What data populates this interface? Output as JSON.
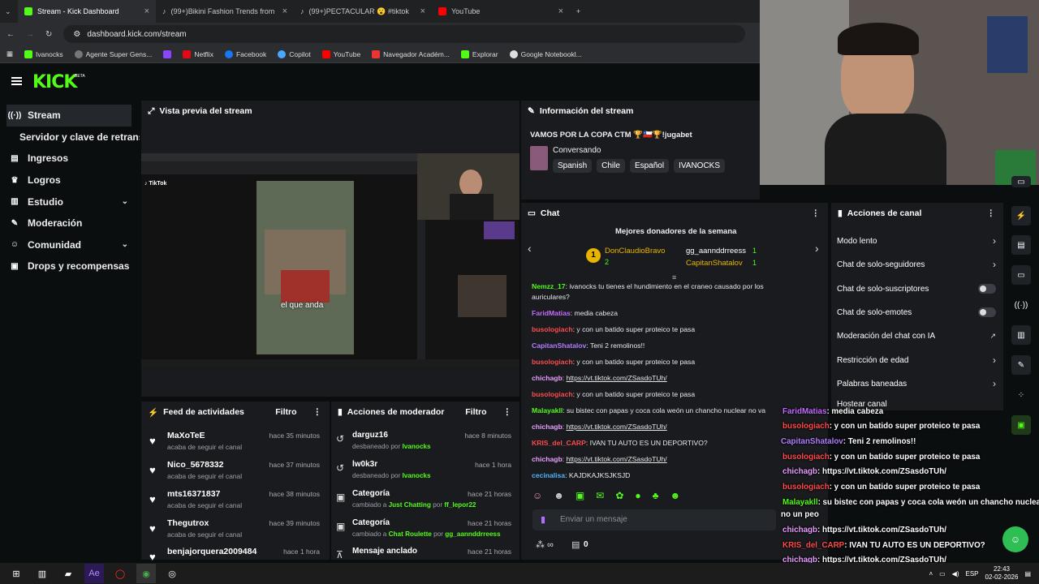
{
  "browser": {
    "tabs": [
      {
        "label": "Stream - Kick Dashboard"
      },
      {
        "label": "(99+)Bikini Fashion Trends from"
      },
      {
        "label": "(99+)PECTACULAR 😮 #tiktok"
      },
      {
        "label": "YouTube"
      }
    ],
    "url": "dashboard.kick.com/stream",
    "bookmarks": [
      "Ivanocks",
      "Agente Super Gens...",
      "Netflix",
      "Facebook",
      "Copilot",
      "YouTube",
      "Navegador Académ...",
      "Explorar",
      "Google Notebookl..."
    ]
  },
  "app": {
    "logo": "KICK",
    "beta": "BETA"
  },
  "sidebar": {
    "items": [
      {
        "label": "Stream"
      },
      {
        "label": "Servidor y clave de retransmisión"
      },
      {
        "label": "Ingresos"
      },
      {
        "label": "Logros"
      },
      {
        "label": "Estudio"
      },
      {
        "label": "Moderación"
      },
      {
        "label": "Comunidad"
      },
      {
        "label": "Drops y recompensas"
      }
    ]
  },
  "preview": {
    "title": "Vista previa del stream",
    "caption": "el que anda"
  },
  "info": {
    "title": "Información del stream",
    "stream_title": "VAMOS POR LA COPA CTM 🏆🇨🇱🏆!jugabet",
    "category": "Conversando",
    "tags": [
      "Spanish",
      "Chile",
      "Español",
      "IVANOCKS"
    ]
  },
  "chat": {
    "title": "Chat",
    "donors_title": "Mejores donadores de la semana",
    "donors": [
      {
        "rank": "1",
        "name": "DonClaudioBravo",
        "amount": "2"
      },
      {
        "rank": "",
        "name": "gg_aannddrreess",
        "amount": "1"
      },
      {
        "rank": "",
        "name": "CapitanShatalov",
        "amount": "1"
      }
    ],
    "messages": [
      {
        "user": "Nemzz_17",
        "color": "#53fc18",
        "text": "ivanocks tu tienes el hundimiento en el craneo causado por los auriculares?"
      },
      {
        "user": "FaridMatias",
        "color": "#c46bff",
        "text": "media cabeza"
      },
      {
        "user": "busologiach",
        "color": "#ff4a4a",
        "text": "y con un batido super proteico te pasa"
      },
      {
        "user": "CapitanShatalov",
        "color": "#b27cff",
        "text": "Teni 2 remolinos!!"
      },
      {
        "user": "busologiach",
        "color": "#ff4a4a",
        "text": "y con un batido super proteico te pasa"
      },
      {
        "user": "chichagb",
        "color": "#e89cff",
        "text": "https://vt.tiktok.com/ZSasdoTUh/"
      },
      {
        "user": "busologiach",
        "color": "#ff4a4a",
        "text": "y con un batido super proteico te pasa"
      },
      {
        "user": "Malayakll",
        "color": "#53fc18",
        "text": "su bistec con papas y coca cola weón un chancho nuclear no va"
      },
      {
        "user": "chichagb",
        "color": "#e89cff",
        "text": "https://vt.tiktok.com/ZSasdoTUh/"
      },
      {
        "user": "KRIS_del_CARP",
        "color": "#ff4a4a",
        "text": "IVAN TU AUTO ES UN DEPORTIVO?"
      },
      {
        "user": "chichagb",
        "color": "#e89cff",
        "text": "https://vt.tiktok.com/ZSasdoTUh/"
      },
      {
        "user": "cecinalisa",
        "color": "#4fb3ff",
        "text": "KAJDKAJKSJKSJD"
      }
    ],
    "placeholder": "Enviar un mensaje",
    "points": "0"
  },
  "actions": {
    "title": "Acciones de canal",
    "items": [
      {
        "label": "Modo lento"
      },
      {
        "label": "Chat de solo-seguidores"
      },
      {
        "label": "Chat de solo-suscriptores"
      },
      {
        "label": "Chat de solo-emotes"
      },
      {
        "label": "Moderación del chat con IA"
      },
      {
        "label": "Restricción de edad"
      },
      {
        "label": "Palabras baneadas"
      },
      {
        "label": "Hostear canal"
      }
    ]
  },
  "feed": {
    "title": "Feed de actividades",
    "filter": "Filtro",
    "rows": [
      {
        "name": "MaXoTeE",
        "sub": "acaba de seguir el canal",
        "time": "hace 35 minutos"
      },
      {
        "name": "Nico_5678332",
        "sub": "acaba de seguir el canal",
        "time": "hace 37 minutos"
      },
      {
        "name": "mts16371837",
        "sub": "acaba de seguir el canal",
        "time": "hace 38 minutos"
      },
      {
        "name": "Thegutrox",
        "sub": "acaba de seguir el canal",
        "time": "hace 39 minutos"
      },
      {
        "name": "benjajorquera2009484",
        "sub": "",
        "time": "hace 1 hora"
      }
    ]
  },
  "modactions": {
    "title": "Acciones de moderador",
    "filter": "Filtro",
    "rows": [
      {
        "name": "darguz16",
        "sub": "desbaneado por",
        "who": "Ivanocks",
        "time": "hace 8 minutos"
      },
      {
        "name": "lw0k3r",
        "sub": "desbaneado por",
        "who": "Ivanocks",
        "time": "hace 1 hora"
      },
      {
        "name": "Categoría",
        "sub": "cambiado a",
        "what": "Just Chatting",
        "by": "por",
        "who": "ff_lepor22",
        "time": "hace 21 horas"
      },
      {
        "name": "Categoría",
        "sub": "cambiado a",
        "what": "Chat Roulette",
        "by": "por",
        "who": "gg_aannddrreess",
        "time": "hace 21 horas"
      },
      {
        "name": "Mensaje anclado",
        "sub": "",
        "who": "",
        "time": "hace 21 horas"
      }
    ]
  },
  "overlay": {
    "lines": [
      {
        "user": "FaridMatias",
        "color": "#c46bff",
        "text": ": media cabeza"
      },
      {
        "user": "busologiach",
        "color": "#ff4a4a",
        "text": ": y con un batido super proteico te pasa"
      },
      {
        "user": "CapitanShatalov",
        "color": "#b27cff",
        "text": ": Teni 2 remolinos!!"
      },
      {
        "user": "busologiach",
        "color": "#ff4a4a",
        "text": ": y con un batido super proteico te pasa"
      },
      {
        "user": "chichagb",
        "color": "#e89cff",
        "text": ": https://vt.tiktok.com/ZSasdoTUh/"
      },
      {
        "user": "busologiach",
        "color": "#ff4a4a",
        "text": ": y con un batido super proteico te pasa"
      },
      {
        "user": "Malayakll",
        "color": "#53fc18",
        "text": ": su bistec con papas y coca cola weón un chancho nuclear"
      },
      {
        "user": "",
        "color": "#fff",
        "text": "no un peo"
      },
      {
        "user": "chichagb",
        "color": "#e89cff",
        "text": ": https://vt.tiktok.com/ZSasdoTUh/"
      },
      {
        "user": "KRIS_del_CARP",
        "color": "#ff4a4a",
        "text": ": IVAN TU AUTO ES UN DEPORTIVO?"
      },
      {
        "user": "chichagb",
        "color": "#e89cff",
        "text": ": https://vt.tiktok.com/ZSasdoTUh/"
      },
      {
        "user": "cecinalisa",
        "color": "#4fb3ff",
        "text": ": KAJDKAJKSJKSJD"
      }
    ]
  },
  "taskbar": {
    "lang": "ESP",
    "time": "22:43",
    "date": "02-02-2026"
  },
  "colors": {
    "accent": "#53fc18",
    "panel": "#191b1f",
    "bg": "#0b0e0f"
  }
}
